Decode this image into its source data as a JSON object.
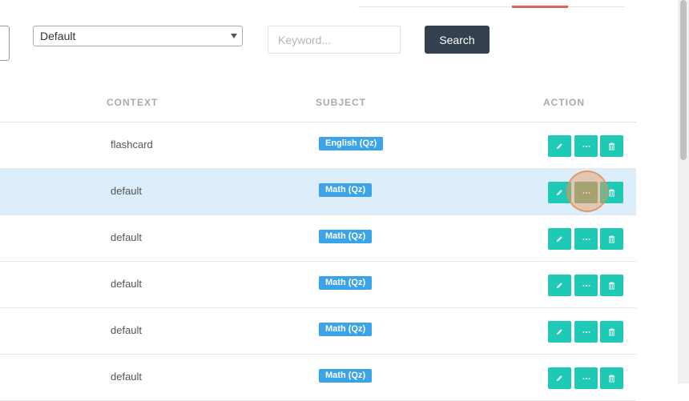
{
  "filter": {
    "select_value": "Default",
    "keyword_placeholder": "Keyword...",
    "search_label": "Search"
  },
  "table": {
    "headers": {
      "context": "CONTEXT",
      "subject": "SUBJECT",
      "action": "ACTION"
    },
    "rows": [
      {
        "context": "flashcard",
        "subject": "English (Qz)"
      },
      {
        "context": "default",
        "subject": "Math (Qz)"
      },
      {
        "context": "default",
        "subject": "Math (Qz)"
      },
      {
        "context": "default",
        "subject": "Math (Qz)"
      },
      {
        "context": "default",
        "subject": "Math (Qz)"
      },
      {
        "context": "default",
        "subject": "Math (Qz)"
      }
    ]
  },
  "icons": {
    "edit": "pencil-icon",
    "more": "ellipsis-icon",
    "delete": "trash-icon"
  },
  "colors": {
    "action_button": "#1ec9b5",
    "badge": "#3ba3e8",
    "search_button": "#36414f",
    "selected_row": "#dbeefa",
    "active_tab": "#e0625c"
  }
}
